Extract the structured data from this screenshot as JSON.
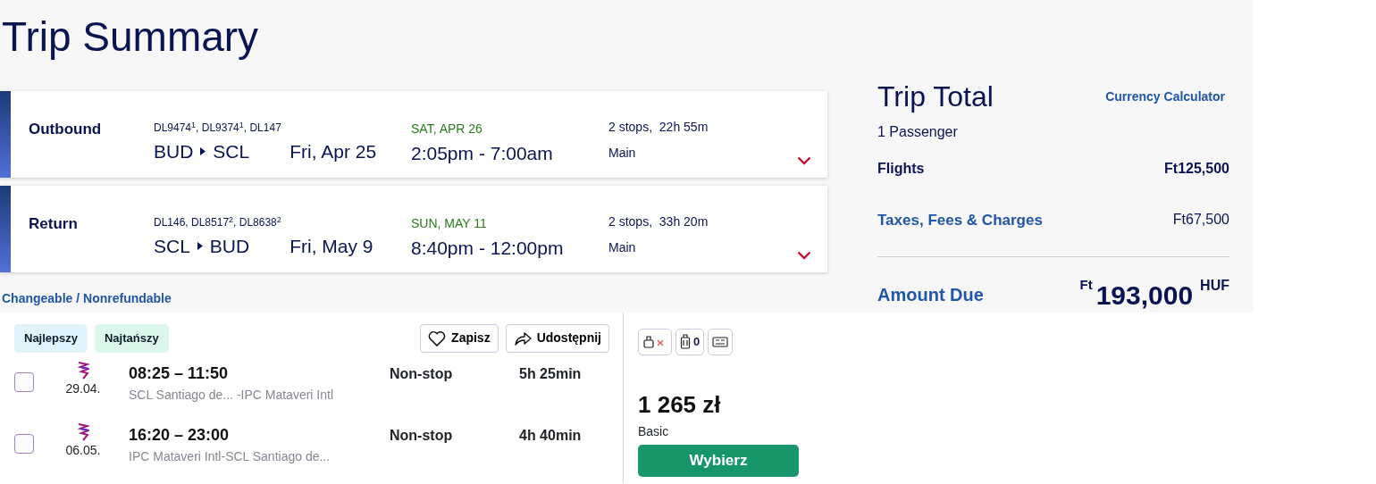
{
  "page_title": "Trip Summary",
  "segments": [
    {
      "label": "Outbound",
      "flights": "DL9474$^{1}$, DL9374$^{1}$, DL147",
      "origin": "BUD",
      "destination": "SCL",
      "date": "Fri, Apr 25",
      "arrival_day": "SAT, APR 26",
      "times": "2:05pm - 7:00am",
      "stops": "2 stops,  22h 55m",
      "cabin": "Main"
    },
    {
      "label": "Return",
      "flights": "DL146, DL8517$^{2}$, DL8638$^{2}$",
      "origin": "SCL",
      "destination": "BUD",
      "date": "Fri, May 9",
      "arrival_day": "SUN, MAY 11",
      "times": "8:40pm - 12:00pm",
      "stops": "2 stops,  33h 20m",
      "cabin": "Main"
    }
  ],
  "fare_rules": "Changeable / Nonrefundable",
  "trip_total": {
    "title": "Trip Total",
    "currency_link": "Currency Calculator",
    "passengers": "1 Passenger",
    "lines": [
      {
        "kind": "plain",
        "label": "Flights",
        "amount": "Ft125,500"
      },
      {
        "kind": "link",
        "label": "Taxes, Fees & Charges",
        "amount": "Ft67,500"
      }
    ],
    "amount_due": {
      "label": "Amount Due",
      "currency_symbol": "Ft",
      "amount": "193,000",
      "currency_code": "HUF"
    }
  },
  "offer": {
    "tags": [
      {
        "label": "Najlepszy",
        "color": "#e0f4fc"
      },
      {
        "label": "Najtańszy",
        "color": "#dbf7ec"
      }
    ],
    "actions": [
      {
        "kind": "save",
        "label": "Zapisz"
      },
      {
        "kind": "share",
        "label": "Udostępnij"
      }
    ],
    "legs": [
      {
        "checked": false,
        "date": "29.04.",
        "times": "08:25 – 11:50",
        "route": "SCL Santiago de... -IPC Mataveri Intl",
        "stops": "Non-stop",
        "duration": "5h 25min"
      },
      {
        "checked": false,
        "date": "06.05.",
        "times": "16:20 – 23:00",
        "route": "IPC Mataveri Intl-SCL Santiago de...",
        "stops": "Non-stop",
        "duration": "4h 40min"
      }
    ],
    "baggage": [
      {
        "kind": "personal"
      },
      {
        "kind": "carry_on",
        "count": "0"
      },
      {
        "kind": "checked"
      }
    ],
    "price": "1 265 zł",
    "fare_class": "Basic",
    "select_button": "Wybierz"
  }
}
